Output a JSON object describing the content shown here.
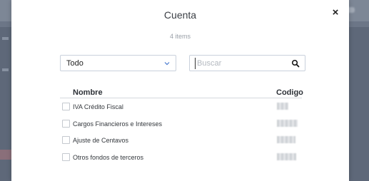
{
  "modal": {
    "title": "Cuenta",
    "close_symbol": "×",
    "count_label": "4 items"
  },
  "filter": {
    "selected": "Todo",
    "chevron_icon": "chevron-down-icon"
  },
  "search": {
    "placeholder": "Buscar",
    "value": "",
    "icon": "search-icon"
  },
  "table": {
    "headers": {
      "name": "Nombre",
      "code": "Codigo"
    },
    "rows": [
      {
        "name": "IVA Crédito Fiscal",
        "checked": false
      },
      {
        "name": "Cargos Financieros e Intereses",
        "checked": false
      },
      {
        "name": "Ajuste de Centavos",
        "checked": false
      },
      {
        "name": "Otros fondos de terceros",
        "checked": false
      }
    ]
  },
  "colors": {
    "overlay": "#6c7687",
    "input_border": "#c9d1dc",
    "chevron": "#4a7bd0"
  }
}
